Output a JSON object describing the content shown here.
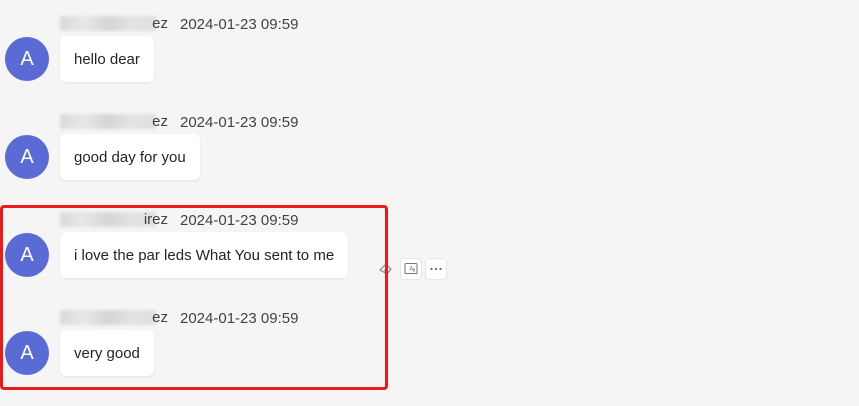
{
  "messages": [
    {
      "sender_suffix": "ez",
      "time": "2024-01-23 09:59",
      "avatar_initial": "A",
      "text": "hello dear"
    },
    {
      "sender_suffix": "ez",
      "time": "2024-01-23 09:59",
      "avatar_initial": "A",
      "text": "good day for you"
    },
    {
      "sender_suffix": "irez",
      "time": "2024-01-23 09:59",
      "avatar_initial": "A",
      "text": "i love the par leds What You sent to me"
    },
    {
      "sender_suffix": "ez",
      "time": "2024-01-23 09:59",
      "avatar_initial": "A",
      "text": "very good"
    }
  ],
  "hover_actions": [
    {
      "icon": "react-icon"
    },
    {
      "icon": "immersive-reader-icon"
    },
    {
      "icon": "more-options-icon"
    }
  ],
  "colors": {
    "avatar": "#5b6bd5",
    "highlight": "#e81c1c",
    "background": "#f5f5f5",
    "bubble": "#ffffff"
  }
}
